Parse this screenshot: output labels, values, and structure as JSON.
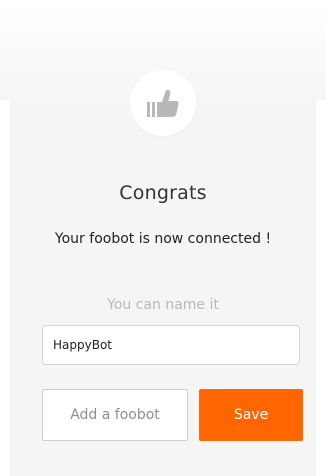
{
  "header": {
    "title": "Congrats",
    "subtitle": "Your foobot is now connected !"
  },
  "badge": {
    "icon": "thumbs-up-icon",
    "icon_color": "#b8b8b8"
  },
  "naming": {
    "prompt": "You can name it",
    "input_value": "HappyBot",
    "input_placeholder": ""
  },
  "actions": {
    "add_label": "Add a foobot",
    "save_label": "Save",
    "save_color": "#ff6600"
  }
}
